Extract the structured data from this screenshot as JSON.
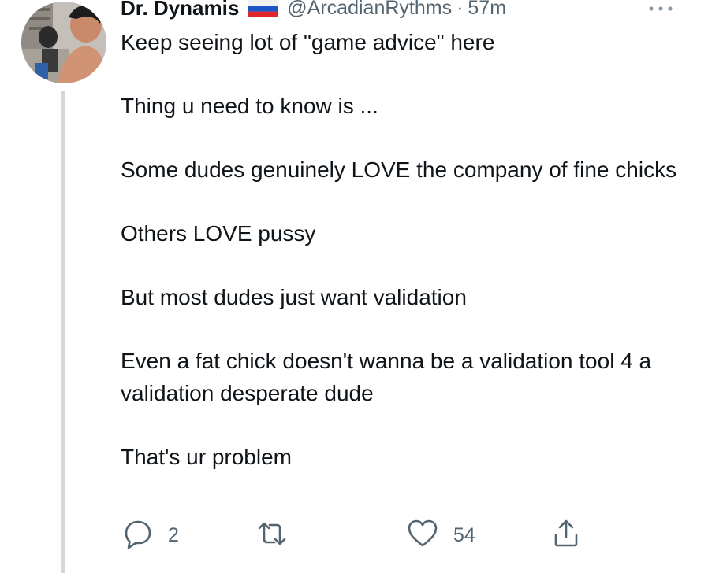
{
  "tweet": {
    "author_name": "Dr. Dynamis",
    "flag_icon": "russia-flag-icon",
    "handle": "@ArcadianRythms",
    "separator": "·",
    "time": "57m",
    "more_icon": "more-icon",
    "paragraphs": [
      "Keep seeing lot of \"game advice\" here",
      "Thing u need to know is ...",
      "Some dudes genuinely LOVE the company of fine chicks",
      "Others LOVE pussy",
      "But most dudes just want validation",
      "Even a fat chick doesn't wanna be a validation tool 4 a validation desperate dude",
      "That's ur problem"
    ],
    "actions": {
      "reply": {
        "icon": "reply-icon",
        "count": "2"
      },
      "retweet": {
        "icon": "retweet-icon",
        "count": ""
      },
      "like": {
        "icon": "heart-icon",
        "count": "54"
      },
      "share": {
        "icon": "share-icon"
      }
    }
  },
  "colors": {
    "text": "#0f1419",
    "secondary": "#536471",
    "thread_line": "#cfd9de",
    "background": "#ffffff"
  }
}
